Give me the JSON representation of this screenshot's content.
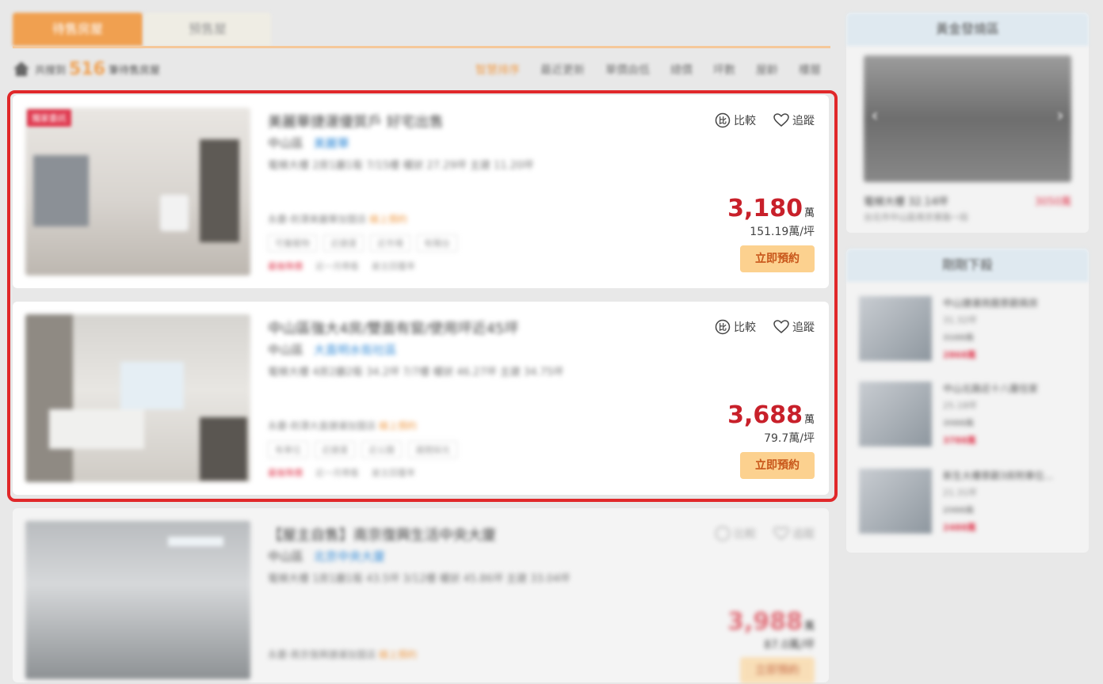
{
  "tabs": {
    "active": "待售房屋",
    "inactive": "預售屋"
  },
  "summary": {
    "prefix": "共搜到",
    "count": "516",
    "suffix": "筆待售房屋"
  },
  "sort": [
    "智慧排序",
    "最近更新",
    "單價由低",
    "總價",
    "坪數",
    "屋齡",
    "樓層"
  ],
  "listings": [
    {
      "badge": "獨家委託",
      "title": "美麗華捷運優質戶 好宅出售",
      "district": "中山區",
      "community": "美麗華",
      "spec": "電梯大樓  2房1廳1衛  7/15樓  權狀 27.29坪  主建 11.20坪",
      "agent": "永慶-劍潭美麗華加盟店",
      "agent_tag": "線上預約",
      "tags": [
        "可養寵物",
        "近捷運",
        "近市場",
        "有陽台"
      ],
      "foot": [
        "最後降價",
        "近一月帶看",
        "屋主回覆率"
      ],
      "compare": "比較",
      "track": "追蹤",
      "price": "3,180",
      "price_unit": "萬",
      "unit_price": "151.19萬/坪",
      "book": "立即預約",
      "img": {
        "base": "#d8d4cf",
        "accent": "#b8b0a6"
      }
    },
    {
      "badge": "",
      "title": "中山區強大4房/雙面有窗/使用坪近45坪",
      "district": "中山區",
      "community": "大直明水街社區",
      "spec": "電梯大樓  4房2廳2衛  34.2坪  7/7樓  權狀 46.27坪  主建 34.75坪",
      "agent": "永慶-劍潭大直捷運加盟店",
      "agent_tag": "線上預約",
      "tags": [
        "有車位",
        "近捷運",
        "近公園",
        "邊間採光"
      ],
      "foot": [
        "最後降價",
        "近一月帶看",
        "屋主回覆率"
      ],
      "compare": "比較",
      "track": "追蹤",
      "price": "3,688",
      "price_unit": "萬",
      "unit_price": "79.7萬/坪",
      "book": "立即預約",
      "img": {
        "base": "#d9d6d1",
        "accent": "#9a948c"
      }
    },
    {
      "badge": "",
      "title": "【屋主自售】南京復興生活中央大廈",
      "district": "中山區",
      "community": "北京中央大廈",
      "spec": "電梯大樓  1房1廳1衛  43.5坪  3/12樓  權狀 45.86坪  主建 33.04坪",
      "agent": "永慶-南京復興捷運加盟店",
      "agent_tag": "線上預約",
      "tags": [],
      "foot": [],
      "compare": "比較",
      "track": "追蹤",
      "price": "3,988",
      "price_unit": "萬",
      "unit_price": "87.0萬/坪",
      "book": "立即預約",
      "img": {
        "base": "#c9cbcd",
        "accent": "#7f8386"
      }
    }
  ],
  "sidebar": {
    "featured": {
      "header": "黃金發燒區",
      "name": "電梯大樓 32.14坪",
      "price": "3050萬",
      "address": "台北市中山區南京東路一段"
    },
    "recent": {
      "header": "剛剛下殺",
      "items": [
        {
          "title": "中山捷運商圈景觀兩房",
          "size": "31.32坪",
          "old": "3188萬",
          "new": "2868萬"
        },
        {
          "title": "中山北路近十八層住家",
          "size": "25.18坪",
          "old": "3988萬",
          "new": "3788萬"
        },
        {
          "title": "新生大樓景觀3房附車位...",
          "size": "21.31坪",
          "old": "2988萬",
          "new": "2488萬"
        }
      ]
    }
  }
}
